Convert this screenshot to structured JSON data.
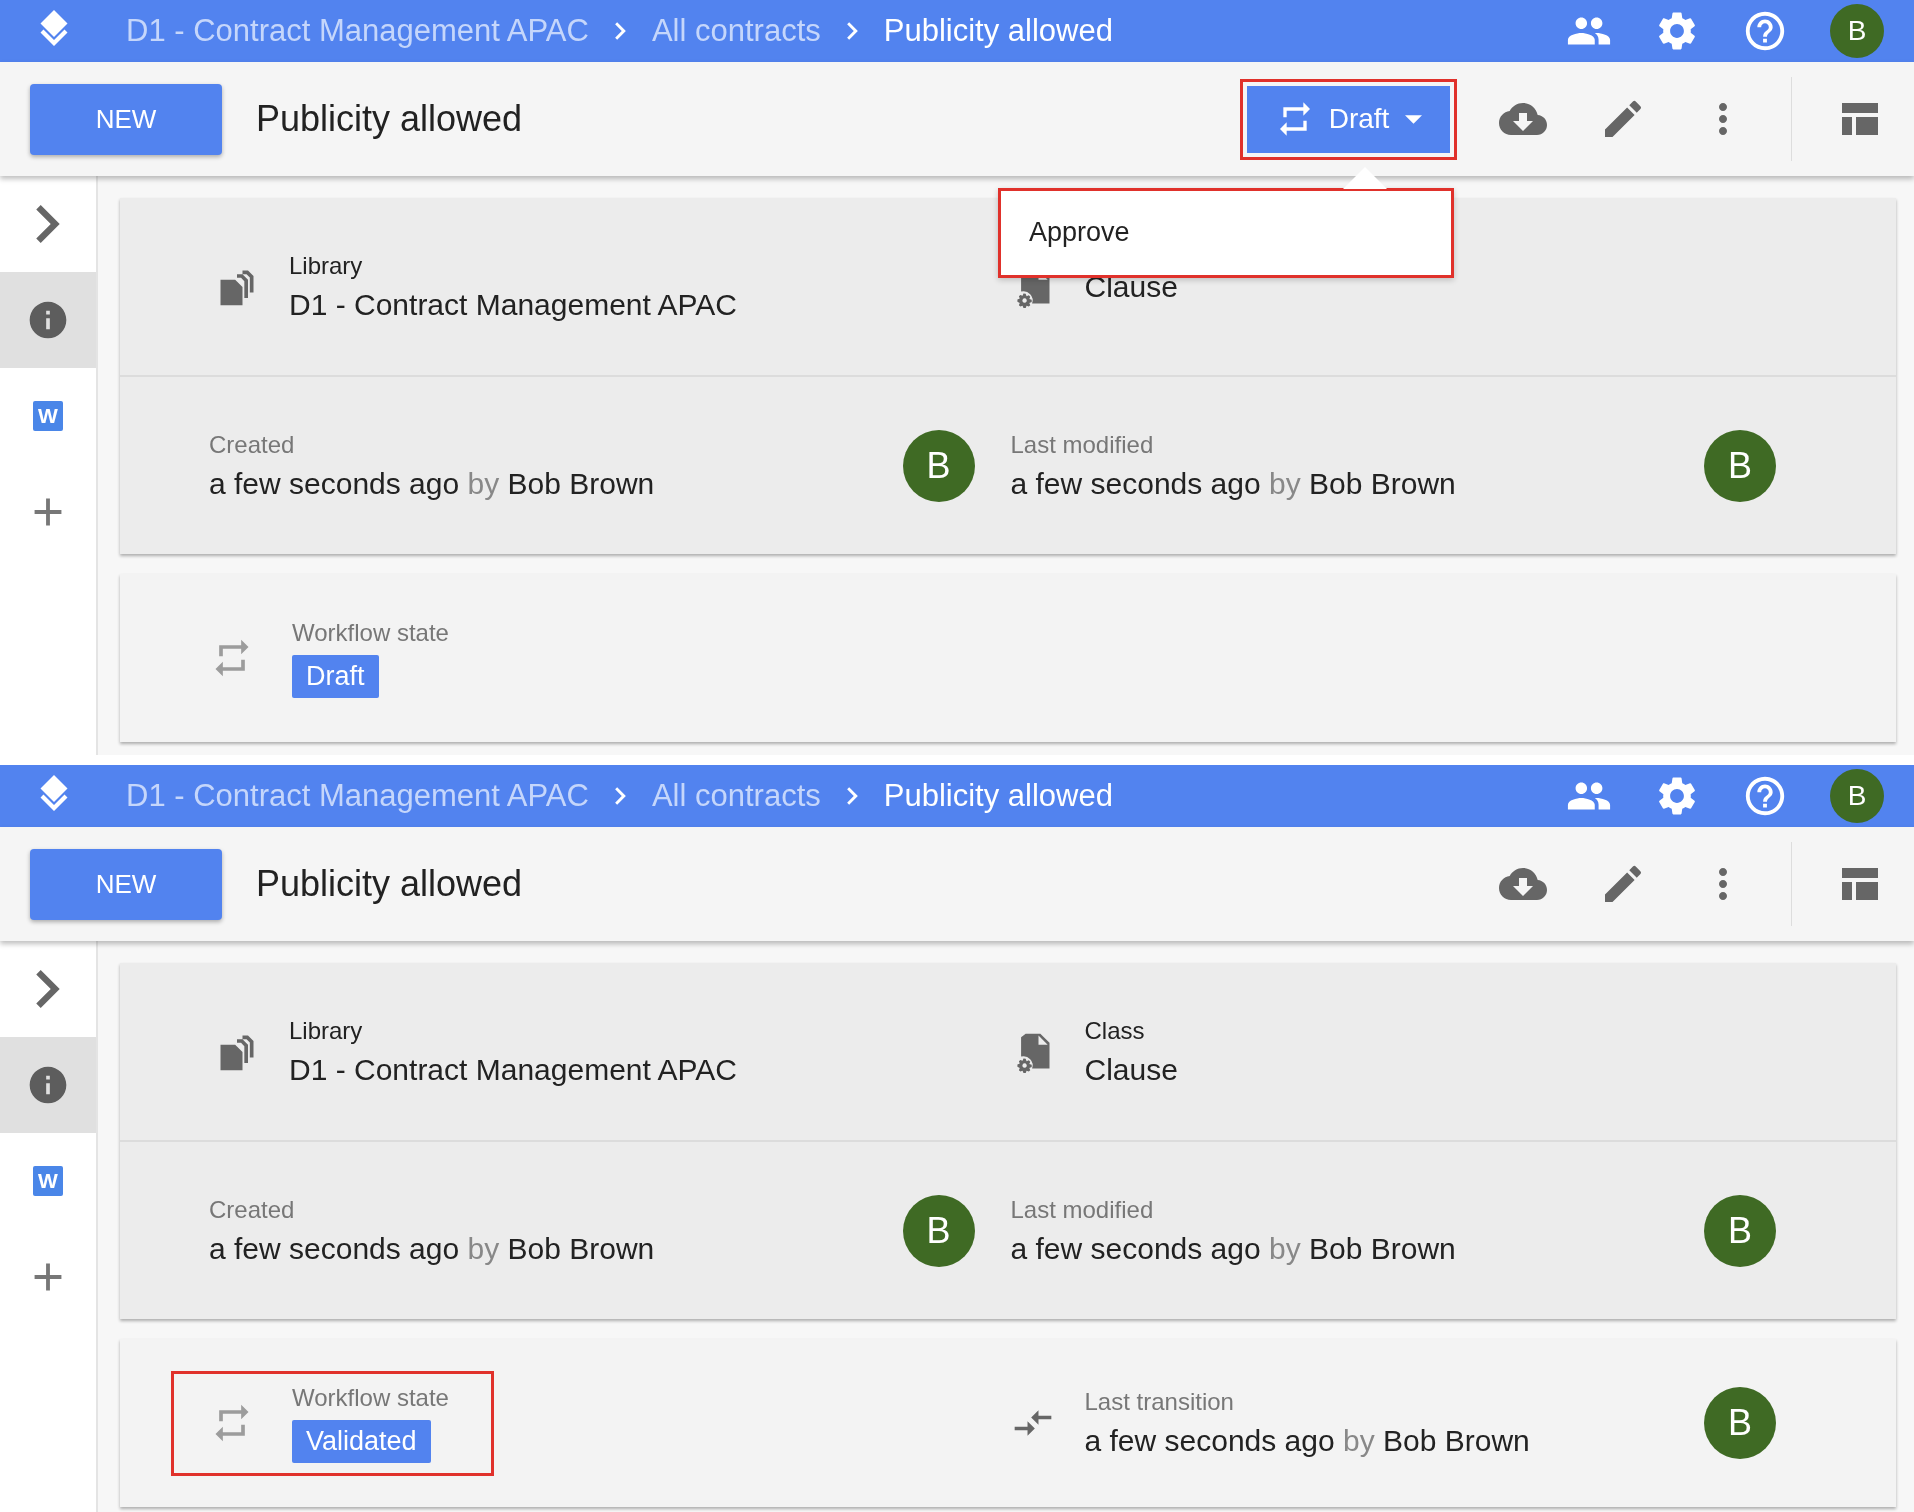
{
  "panels": [
    {
      "header": {
        "breadcrumbs": [
          {
            "label": "D1 - Contract Management APAC",
            "current": false
          },
          {
            "label": "All contracts",
            "current": false
          },
          {
            "label": "Publicity allowed",
            "current": true
          }
        ],
        "avatar": "B"
      },
      "toolbar": {
        "new_button": "NEW",
        "title": "Publicity allowed",
        "state_button": {
          "label": "Draft",
          "highlighted": true
        },
        "menu": {
          "items": [
            "Approve"
          ],
          "highlighted": true
        }
      },
      "sidebar": [
        {
          "kind": "expand",
          "selected": false
        },
        {
          "kind": "info",
          "selected": true
        },
        {
          "kind": "word",
          "label": "W",
          "selected": false
        },
        {
          "kind": "add",
          "selected": false
        }
      ],
      "cards": [
        {
          "rows": [
            {
              "fields": [
                {
                  "kind": "library",
                  "label": "Library",
                  "value": "D1 - Contract Management APAC"
                },
                {
                  "kind": "class",
                  "value": "Clause"
                }
              ]
            },
            {
              "fields": [
                {
                  "kind": "audit",
                  "label": "Created",
                  "time": "a few seconds ago",
                  "by": "by",
                  "user": "Bob Brown",
                  "avatar": "B"
                },
                {
                  "kind": "audit",
                  "label": "Last modified",
                  "time": "a few seconds ago",
                  "by": "by",
                  "user": "Bob Brown",
                  "avatar": "B"
                }
              ]
            }
          ]
        },
        {
          "rows": [
            {
              "fields": [
                {
                  "kind": "workflow",
                  "label": "Workflow state",
                  "badge": "Draft",
                  "highlighted": false
                }
              ]
            }
          ]
        }
      ]
    },
    {
      "header": {
        "breadcrumbs": [
          {
            "label": "D1 - Contract Management APAC",
            "current": false
          },
          {
            "label": "All contracts",
            "current": false
          },
          {
            "label": "Publicity allowed",
            "current": true
          }
        ],
        "avatar": "B"
      },
      "toolbar": {
        "new_button": "NEW",
        "title": "Publicity allowed"
      },
      "sidebar": [
        {
          "kind": "expand",
          "selected": false
        },
        {
          "kind": "info",
          "selected": true
        },
        {
          "kind": "word",
          "label": "W",
          "selected": false
        },
        {
          "kind": "add",
          "selected": false
        }
      ],
      "cards": [
        {
          "rows": [
            {
              "fields": [
                {
                  "kind": "library",
                  "label": "Library",
                  "value": "D1 - Contract Management APAC"
                },
                {
                  "kind": "class",
                  "label": "Class",
                  "value": "Clause"
                }
              ]
            },
            {
              "fields": [
                {
                  "kind": "audit",
                  "label": "Created",
                  "time": "a few seconds ago",
                  "by": "by",
                  "user": "Bob Brown",
                  "avatar": "B"
                },
                {
                  "kind": "audit",
                  "label": "Last modified",
                  "time": "a few seconds ago",
                  "by": "by",
                  "user": "Bob Brown",
                  "avatar": "B"
                }
              ]
            }
          ]
        },
        {
          "rows": [
            {
              "fields": [
                {
                  "kind": "workflow",
                  "label": "Workflow state",
                  "badge": "Validated",
                  "highlighted": true
                },
                {
                  "kind": "transition",
                  "label": "Last transition",
                  "time": "a few seconds ago",
                  "by": "by",
                  "user": "Bob Brown",
                  "avatar": "B"
                }
              ]
            }
          ]
        }
      ]
    }
  ]
}
